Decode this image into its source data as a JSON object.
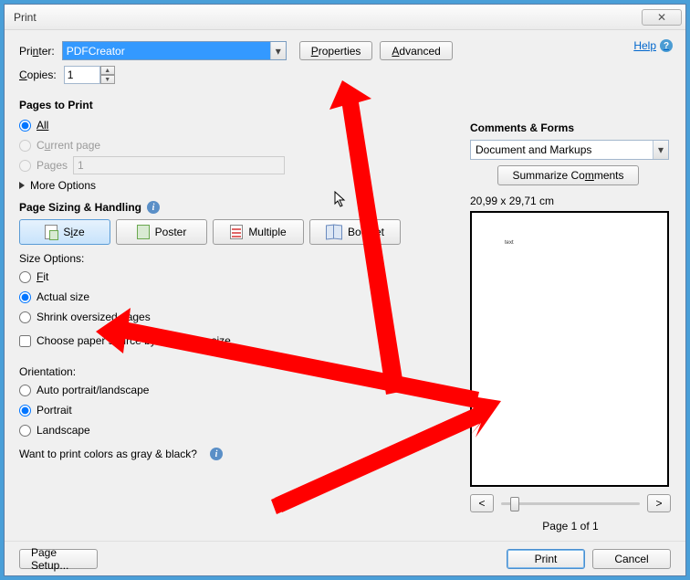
{
  "title": "Print",
  "help_label": "Help",
  "printer": {
    "label": "Printer:",
    "value": "PDFCreator",
    "properties": "Properties",
    "advanced": "Advanced"
  },
  "copies": {
    "label": "Copies:",
    "value": "1"
  },
  "pages_to_print": {
    "title": "Pages to Print",
    "all": "All",
    "current": "Current page",
    "pages": "Pages",
    "pages_value": "1",
    "more": "More Options"
  },
  "sizing": {
    "title": "Page Sizing & Handling",
    "tabs": {
      "size": "Size",
      "poster": "Poster",
      "multiple": "Multiple",
      "booklet": "Booklet"
    },
    "options_label": "Size Options:",
    "fit": "Fit",
    "actual": "Actual size",
    "shrink": "Shrink oversized pages",
    "paper_source": "Choose paper source by PDF page size"
  },
  "orientation": {
    "title": "Orientation:",
    "auto": "Auto portrait/landscape",
    "portrait": "Portrait",
    "landscape": "Landscape"
  },
  "grayscale_q": "Want to print colors as gray & black?",
  "comments": {
    "title": "Comments & Forms",
    "selected": "Document and Markups",
    "summarize": "Summarize Comments"
  },
  "preview": {
    "dims": "20,99 x 29,71 cm",
    "tiny_text": "text",
    "pageof": "Page 1 of 1"
  },
  "footer": {
    "page_setup": "Page Setup...",
    "print": "Print",
    "cancel": "Cancel"
  }
}
